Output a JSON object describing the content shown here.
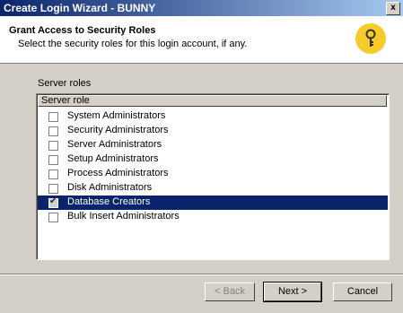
{
  "window": {
    "title": "Create Login Wizard - BUNNY",
    "close": "x"
  },
  "header": {
    "title": "Grant Access to Security Roles",
    "subtitle": "Select the security roles for this login account, if any.",
    "icon": "key-icon"
  },
  "group_label": "Server roles",
  "list": {
    "column_header": "Server role",
    "items": [
      {
        "label": "System Administrators",
        "checked": false,
        "selected": false
      },
      {
        "label": "Security Administrators",
        "checked": false,
        "selected": false
      },
      {
        "label": "Server Administrators",
        "checked": false,
        "selected": false
      },
      {
        "label": "Setup Administrators",
        "checked": false,
        "selected": false
      },
      {
        "label": "Process Administrators",
        "checked": false,
        "selected": false
      },
      {
        "label": "Disk Administrators",
        "checked": false,
        "selected": false
      },
      {
        "label": "Database Creators",
        "checked": true,
        "selected": true
      },
      {
        "label": "Bulk Insert Administrators",
        "checked": false,
        "selected": false
      }
    ]
  },
  "buttons": {
    "back": "< Back",
    "next": "Next >",
    "cancel": "Cancel"
  },
  "colors": {
    "selection": "#0a246a",
    "dialog_bg": "#d4d0c8",
    "key_badge": "#f5cc2a"
  }
}
